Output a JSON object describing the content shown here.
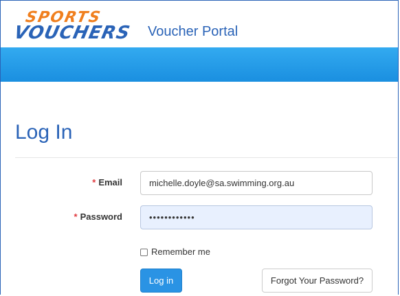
{
  "header": {
    "logo_top": "SPORTS",
    "logo_bottom": "VOUCHERS",
    "portal_title": "Voucher Portal"
  },
  "main": {
    "heading": "Log In"
  },
  "form": {
    "required_mark": "*",
    "email": {
      "label": "Email",
      "value": "michelle.doyle@sa.swimming.org.au"
    },
    "password": {
      "label": "Password",
      "value": "••••••••••••"
    },
    "remember": {
      "label": "Remember me",
      "checked": false
    },
    "login_button": "Log in",
    "forgot_button": "Forgot Your Password?"
  },
  "colors": {
    "brand_blue": "#2a63b7",
    "brand_orange": "#f07f1e",
    "bar_blue": "#1a8fe0",
    "required_red": "#e0393e",
    "autofill_bg": "#e8f0fe"
  }
}
